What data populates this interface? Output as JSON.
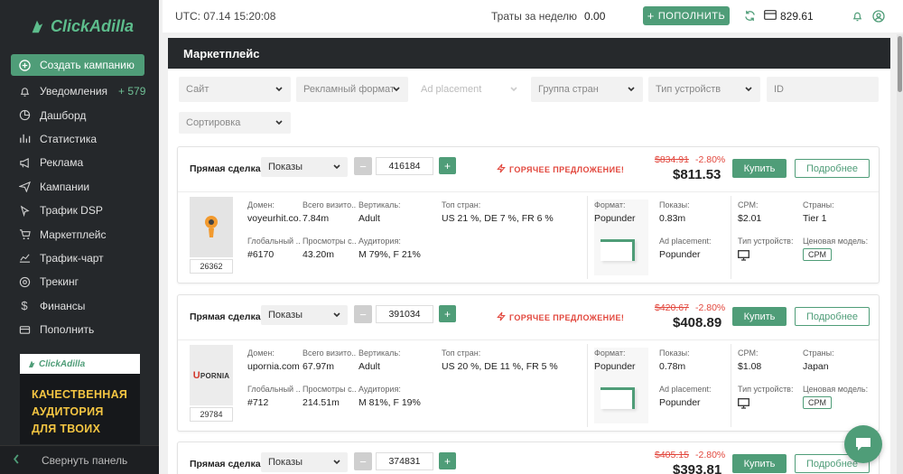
{
  "brand": {
    "name": "ClickAdilla"
  },
  "colors": {
    "accent": "#4f9d78",
    "sidebar": "#25282b",
    "hot": "#e2473d"
  },
  "sidebar": {
    "create_label": "Создать кампанию",
    "items": [
      {
        "label": "Уведомления",
        "count": "+ 579",
        "icon": "bell-icon"
      },
      {
        "label": "Дашборд",
        "icon": "pie-chart-icon"
      },
      {
        "label": "Статистика",
        "icon": "bar-chart-icon"
      },
      {
        "label": "Реклама",
        "icon": "megaphone-icon"
      },
      {
        "label": "Кампании",
        "icon": "send-icon"
      },
      {
        "label": "Трафик DSP",
        "icon": "pointer-icon"
      },
      {
        "label": "Маркетплейс",
        "icon": "cart-icon"
      },
      {
        "label": "Трафик-чарт",
        "icon": "trend-icon"
      },
      {
        "label": "Трекинг",
        "icon": "target-icon"
      },
      {
        "label": "Финансы",
        "icon": "dollar-icon"
      },
      {
        "label": "Пополнить",
        "icon": "wallet-icon"
      }
    ],
    "banner": {
      "brand": "ClickAdilla",
      "text": [
        "КАЧЕСТВЕННАЯ",
        "АУДИТОРИЯ",
        "ДЛЯ ТВОИХ"
      ]
    },
    "collapse_label": "Свернуть панель"
  },
  "topbar": {
    "utc": "UTC: 07.14 15:20:08",
    "spend_label": "Траты за неделю",
    "spend_value": "0.00",
    "topup_label": "ПОПОЛНИТЬ",
    "balance": "829.61"
  },
  "page": {
    "title": "Маркетплейс",
    "filters": {
      "site": "Сайт",
      "ad_format": "Рекламный формат",
      "ad_placement": "Ad placement",
      "country_group": "Группа стран",
      "device_type": "Тип устройств",
      "id": "ID",
      "sort": "Сортировка"
    }
  },
  "labels": {
    "deal": "Прямая сделка:",
    "hot": "ГОРЯЧЕЕ ПРЕДЛОЖЕНИЕ!",
    "buy": "Купить",
    "more": "Подробнее",
    "domain": "Домен:",
    "total_visits": "Всего визито...",
    "vertical": "Вертикаль:",
    "top_countries": "Топ стран:",
    "global_rank": "Глобальный ...",
    "page_views": "Просмотры с...",
    "audience": "Аудитория:",
    "format": "Формат:",
    "impressions": "Показы:",
    "ad_placement": "Ad placement:",
    "cpm": "CPM:",
    "device_type": "Тип устройств:",
    "countries": "Страны:",
    "pricing_model": "Ценовая модель:"
  },
  "offers": [
    {
      "type_select": "Показы",
      "quantity": "416184",
      "old_price": "$834.91",
      "discount": "-2.80%",
      "price": "$811.53",
      "thumb_id": "26362",
      "domain": "voyeurhit.co...",
      "total_visits": "7.84m",
      "vertical": "Adult",
      "top_countries": "US 21 %, DE 7 %, FR 6 %",
      "global_rank": "#6170",
      "page_views": "43.20m",
      "audience": "M 79%, F 21%",
      "format": "Popunder",
      "impressions": "0.83m",
      "ad_placement": "Popunder",
      "cpm": "$2.01",
      "countries": "Tier 1",
      "pricing_model": "CPM"
    },
    {
      "type_select": "Показы",
      "quantity": "391034",
      "old_price": "$420.67",
      "discount": "-2.80%",
      "price": "$408.89",
      "thumb_id": "29784",
      "thumb_brand": "UPORNIA",
      "domain": "upornia.com",
      "total_visits": "67.97m",
      "vertical": "Adult",
      "top_countries": "US 20 %, DE 11 %, FR 5 %",
      "global_rank": "#712",
      "page_views": "214.51m",
      "audience": "M 81%, F 19%",
      "format": "Popunder",
      "impressions": "0.78m",
      "ad_placement": "Popunder",
      "cpm": "$1.08",
      "countries": "Japan",
      "pricing_model": "CPM"
    },
    {
      "type_select": "Показы",
      "quantity": "374831",
      "old_price": "$405.15",
      "discount": "-2.80%",
      "price": "$393.81"
    }
  ]
}
